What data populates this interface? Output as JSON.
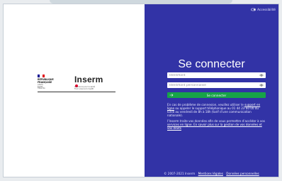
{
  "accessibility": {
    "label": "Accessibilité"
  },
  "left": {
    "republique": {
      "line1": "RÉPUBLIQUE",
      "line2": "FRANÇAISE",
      "motto": "Liberté\nÉgalité\nFraternité"
    },
    "inserm": {
      "name": "Inserm",
      "tagline": "La science pour la santé\nFrom science to health"
    }
  },
  "login": {
    "title": "Se connecter",
    "identifier_placeholder": "Identifiant",
    "password_placeholder": "Identifiant personnalisé",
    "submit_label": "Se connecter"
  },
  "help": {
    "text_before": "En cas de problème de connexion, veuillez utiliser le",
    "link_text": "support en ligne",
    "text_after": "ou appeler le support téléphonique au 01 44 23 60 00 du lundi au vendredi de 8h à 18h (tarif d’une communication nationale)."
  },
  "privacy": {
    "text_before": "l’Inserm traite vos données afin de vous permettre d’accéder à vos",
    "link_text": "services en ligne. En savoir plus sur la gestion de vos données et vos droits",
    "text_after": ""
  },
  "footer": {
    "copyright": "© 2007-2021 Inserm",
    "links": [
      "Mentions légales",
      "Données personnelles"
    ]
  },
  "colors": {
    "panel": "#3233a6",
    "button": "#17a348",
    "inserm_red": "#e4002b",
    "flag_blue": "#000091",
    "flag_white": "#ffffff",
    "flag_red": "#e1000f"
  }
}
